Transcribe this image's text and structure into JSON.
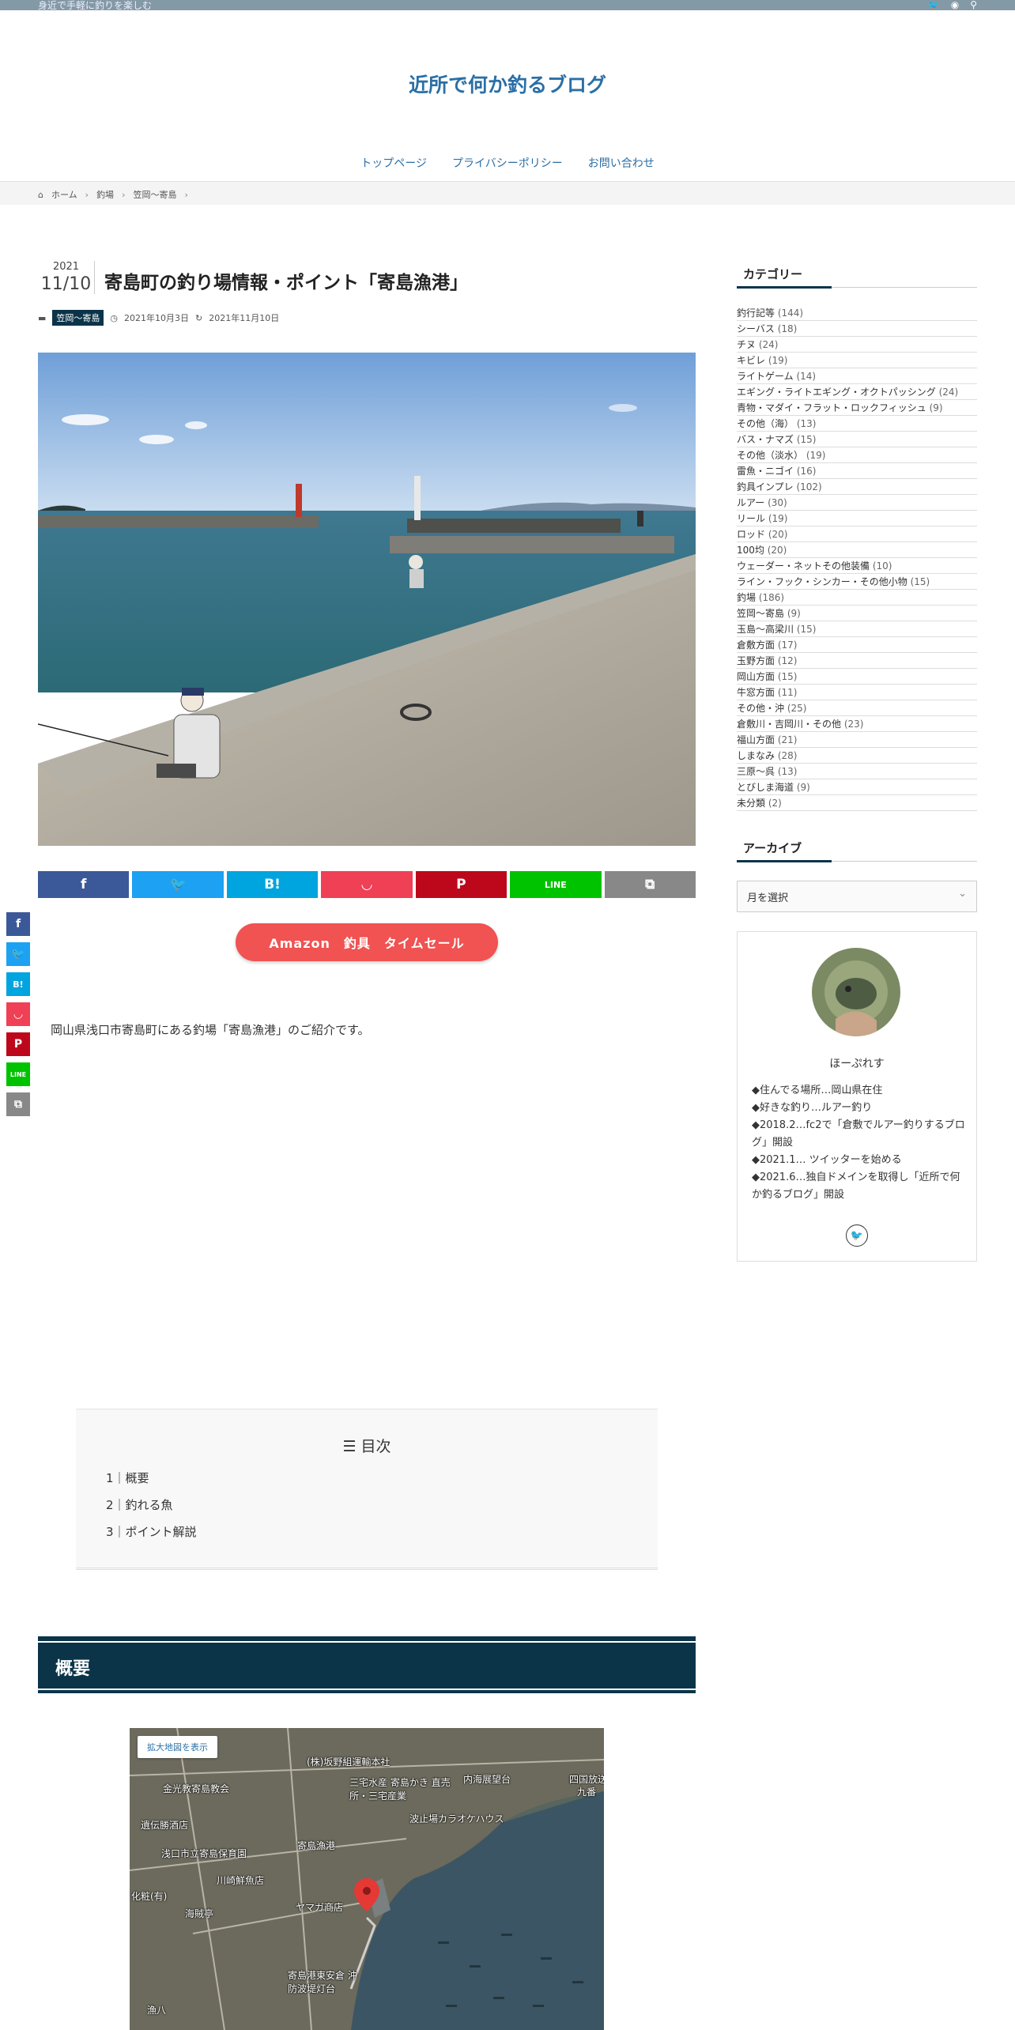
{
  "topbar": {
    "tagline": "身近で手軽に釣りを楽しむ"
  },
  "site": {
    "title": "近所で何か釣るブログ"
  },
  "nav": [
    "トップページ",
    "プライバシーポリシー",
    "お問い合わせ"
  ],
  "breadcrumb": [
    "ホーム",
    "釣場",
    "笠岡～寄島"
  ],
  "post": {
    "year": "2021",
    "month_day": "11/10",
    "title": "寄島町の釣り場情報・ポイント「寄島漁港」",
    "category": "笠岡～寄島",
    "published": "2021年10月3日",
    "updated": "2021年11月10日",
    "intro": "岡山県浅口市寄島町にある釣場「寄島漁港」のご紹介です。"
  },
  "share_icons": [
    "facebook-icon",
    "twitter-icon",
    "hatena-bookmark-icon",
    "pocket-icon",
    "pinterest-icon",
    "line-icon",
    "copy-icon"
  ],
  "share_colors": [
    "#3b5998",
    "#1da1f2",
    "#00a4de",
    "#ef4056",
    "#bd081c",
    "#00c300",
    "#888888"
  ],
  "share_glyphs": [
    "f",
    "🐦",
    "B!",
    "◡",
    "P",
    "LINE",
    "⧉"
  ],
  "amazon_button": "Amazon　釣具　タイムセール",
  "toc": {
    "title": "目次",
    "items": [
      "1｜概要",
      "2｜釣れる魚",
      "3｜ポイント解説"
    ]
  },
  "section_heading": "概要",
  "map": {
    "enlarge": "拡大地図を表示",
    "labels": [
      "(株)坂野組運輸本社",
      "内海展望台",
      "四国放送",
      "九番",
      "金光教寄島教会",
      "三宅水産 寄島かき 直売所・三宅産業",
      "波止場カラオケハウス",
      "遺伝勝酒店",
      "浅口市立寄島保育園",
      "寄島漁港",
      "川崎鮮魚店",
      "化粧(有)",
      "ヤマガ商店",
      "海賊亭",
      "寄島港東安倉 沖防波堤灯台",
      "漁八"
    ]
  },
  "sidebar": {
    "category_title": "カテゴリー",
    "categories": [
      {
        "name": "釣行記等",
        "count": "(144)"
      },
      {
        "name": "シーバス",
        "count": "(18)"
      },
      {
        "name": "チヌ",
        "count": "(24)"
      },
      {
        "name": "キビレ",
        "count": "(19)"
      },
      {
        "name": "ライトゲーム",
        "count": "(14)"
      },
      {
        "name": "エギング・ライトエギング・オクトパッシング",
        "count": "(24)"
      },
      {
        "name": "青物・マダイ・フラット・ロックフィッシュ",
        "count": "(9)"
      },
      {
        "name": "その他（海）",
        "count": "(13)"
      },
      {
        "name": "バス・ナマズ",
        "count": "(15)"
      },
      {
        "name": "その他（淡水）",
        "count": "(19)"
      },
      {
        "name": "雷魚・ニゴイ",
        "count": "(16)"
      },
      {
        "name": "釣具インプレ",
        "count": "(102)"
      },
      {
        "name": "ルアー",
        "count": "(30)"
      },
      {
        "name": "リール",
        "count": "(19)"
      },
      {
        "name": "ロッド",
        "count": "(20)"
      },
      {
        "name": "100均",
        "count": "(20)"
      },
      {
        "name": "ウェーダー・ネットその他装備",
        "count": "(10)"
      },
      {
        "name": "ライン・フック・シンカー・その他小物",
        "count": "(15)"
      },
      {
        "name": "釣場",
        "count": "(186)"
      },
      {
        "name": "笠岡～寄島",
        "count": "(9)"
      },
      {
        "name": "玉島～高梁川",
        "count": "(15)"
      },
      {
        "name": "倉敷方面",
        "count": "(17)"
      },
      {
        "name": "玉野方面",
        "count": "(12)"
      },
      {
        "name": "岡山方面",
        "count": "(15)"
      },
      {
        "name": "牛窓方面",
        "count": "(11)"
      },
      {
        "name": "その他・沖",
        "count": "(25)"
      },
      {
        "name": "倉敷川・吉岡川・その他",
        "count": "(23)"
      },
      {
        "name": "福山方面",
        "count": "(21)"
      },
      {
        "name": "しまなみ",
        "count": "(28)"
      },
      {
        "name": "三原～呉",
        "count": "(13)"
      },
      {
        "name": "とびしま海道",
        "count": "(9)"
      },
      {
        "name": "未分類",
        "count": "(2)"
      }
    ],
    "archive_title": "アーカイブ",
    "archive_select": "月を選択",
    "profile": {
      "name": "ほーぷれす",
      "bio": [
        "◆住んでる場所…岡山県在住",
        "◆好きな釣り…ルアー釣り",
        "◆2018.2…fc2で「倉敷でルアー釣りするブログ」開設",
        "◆2021.1… ツイッターを始める",
        "◆2021.6…独自ドメインを取得し「近所で何か釣るブログ」開設"
      ]
    }
  }
}
